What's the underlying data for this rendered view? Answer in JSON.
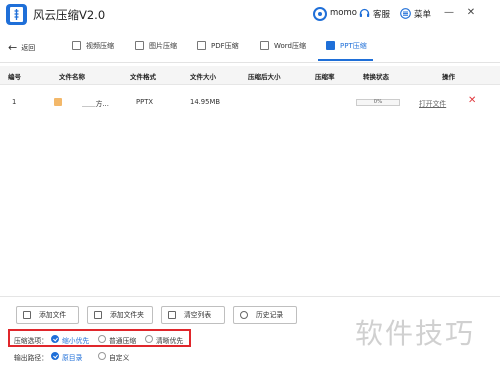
{
  "app": {
    "title": "风云压缩V2.0"
  },
  "header": {
    "user_name": "momo",
    "service_label": "客服",
    "menu_label": "菜单",
    "minimize": "—",
    "close": "✕"
  },
  "nav": {
    "back_label": "返回",
    "tabs": [
      {
        "label": "视频压缩",
        "active": false
      },
      {
        "label": "图片压缩",
        "active": false
      },
      {
        "label": "PDF压缩",
        "active": false
      },
      {
        "label": "Word压缩",
        "active": false
      },
      {
        "label": "PPT压缩",
        "active": true
      }
    ]
  },
  "table": {
    "columns": [
      "编号",
      "文件名称",
      "文件格式",
      "文件大小",
      "压缩后大小",
      "压缩率",
      "转换状态",
      "操作"
    ],
    "rows": [
      {
        "index": "1",
        "name": "＿＿方...",
        "format": "PPTX",
        "size": "14.95MB",
        "compressed_size": "",
        "ratio": "",
        "progress": 0,
        "progress_text": "0%",
        "action": "打开文件"
      }
    ]
  },
  "buttons": {
    "add_file": "添加文件",
    "add_folder": "添加文件夹",
    "clear_list": "清空列表",
    "history": "历史记录"
  },
  "options": {
    "label": "压缩选项：",
    "choices": [
      {
        "label": "缩小优先",
        "checked": true
      },
      {
        "label": "普通压缩",
        "checked": false
      },
      {
        "label": "清晰优先",
        "checked": false
      }
    ]
  },
  "output": {
    "label": "输出路径：",
    "choices": [
      {
        "label": "原目录",
        "checked": true
      },
      {
        "label": "自定义",
        "checked": false
      }
    ]
  },
  "watermark": "软件技巧",
  "colors": {
    "accent": "#1f6fd8",
    "highlight_border": "#e0262b",
    "delete": "#e0393e"
  }
}
